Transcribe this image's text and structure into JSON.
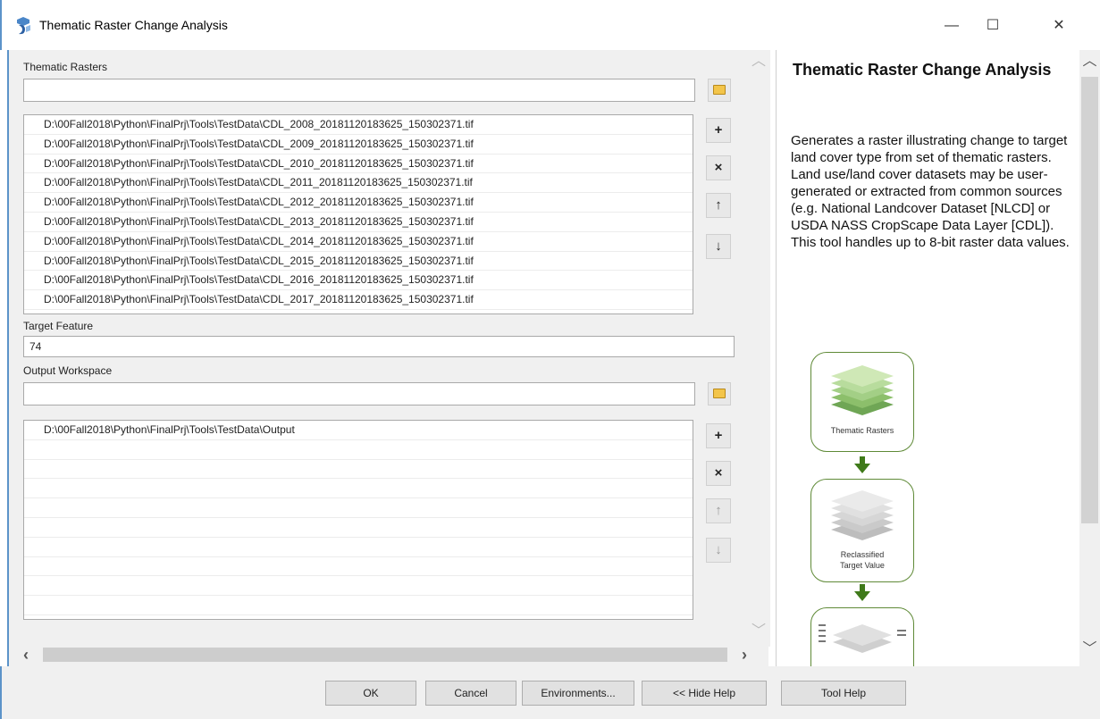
{
  "window": {
    "title": "Thematic Raster Change Analysis",
    "minimize": "—",
    "maximize": "☐",
    "close": "✕"
  },
  "form": {
    "thematic_rasters_label": "Thematic Rasters",
    "thematic_rasters_input": "",
    "thematic_rasters": [
      "D:\\00Fall2018\\Python\\FinalPrj\\Tools\\TestData\\CDL_2008_20181120183625_150302371.tif",
      "D:\\00Fall2018\\Python\\FinalPrj\\Tools\\TestData\\CDL_2009_20181120183625_150302371.tif",
      "D:\\00Fall2018\\Python\\FinalPrj\\Tools\\TestData\\CDL_2010_20181120183625_150302371.tif",
      "D:\\00Fall2018\\Python\\FinalPrj\\Tools\\TestData\\CDL_2011_20181120183625_150302371.tif",
      "D:\\00Fall2018\\Python\\FinalPrj\\Tools\\TestData\\CDL_2012_20181120183625_150302371.tif",
      "D:\\00Fall2018\\Python\\FinalPrj\\Tools\\TestData\\CDL_2013_20181120183625_150302371.tif",
      "D:\\00Fall2018\\Python\\FinalPrj\\Tools\\TestData\\CDL_2014_20181120183625_150302371.tif",
      "D:\\00Fall2018\\Python\\FinalPrj\\Tools\\TestData\\CDL_2015_20181120183625_150302371.tif",
      "D:\\00Fall2018\\Python\\FinalPrj\\Tools\\TestData\\CDL_2016_20181120183625_150302371.tif",
      "D:\\00Fall2018\\Python\\FinalPrj\\Tools\\TestData\\CDL_2017_20181120183625_150302371.tif"
    ],
    "target_feature_label": "Target Feature",
    "target_feature_value": "74",
    "output_workspace_label": "Output Workspace",
    "output_workspace_input": "",
    "output_workspaces": [
      "D:\\00Fall2018\\Python\\FinalPrj\\Tools\\TestData\\Output"
    ],
    "btn_add": "+",
    "btn_remove": "×",
    "btn_up": "↑",
    "btn_down": "↓"
  },
  "help": {
    "title": "Thematic Raster Change Analysis",
    "body": "Generates a raster illustrating change to target land cover type from set of thematic rasters. Land use/land cover datasets may be user-generated or extracted from common sources (e.g. National Landcover Dataset [NLCD] or USDA NASS CropScape Data Layer [CDL]). This tool handles up to 8-bit raster data values.",
    "diagram_labels": [
      "Thematic Rasters",
      "Reclassified",
      "Target Value"
    ]
  },
  "buttons": {
    "ok": "OK",
    "cancel": "Cancel",
    "environments": "Environments...",
    "hide_help": "<< Hide Help",
    "tool_help": "Tool Help"
  },
  "colors": {
    "accent": "#5c93c9",
    "diagram_green": "#3f7a1a"
  }
}
